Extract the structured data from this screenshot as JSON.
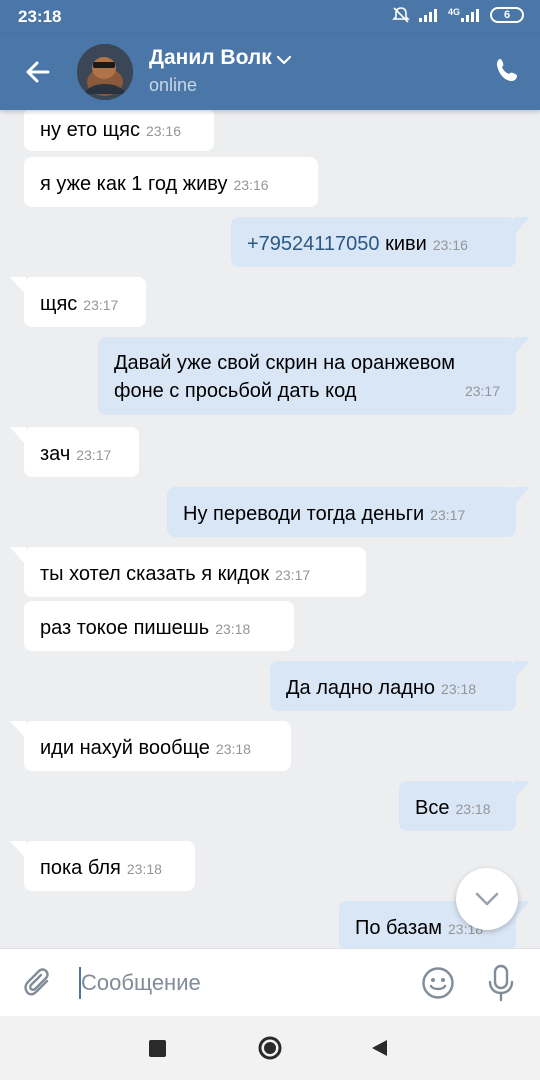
{
  "status_bar": {
    "time": "23:18",
    "network": "4G",
    "battery": "6"
  },
  "header": {
    "name": "Данил Волк",
    "status": "online"
  },
  "messages": [
    {
      "dir": "in",
      "text": "ну ето щяс",
      "time": "23:16"
    },
    {
      "dir": "in",
      "text": "я уже как 1 год живу",
      "time": "23:16"
    },
    {
      "dir": "out",
      "phone": "+79524117050",
      "text": " киви",
      "time": "23:16"
    },
    {
      "dir": "in",
      "text": "щяс",
      "time": "23:17"
    },
    {
      "dir": "out",
      "text": "Давай уже свой скрин на оранжевом фоне с просьбой дать код",
      "time": "23:17"
    },
    {
      "dir": "in",
      "text": "зач",
      "time": "23:17"
    },
    {
      "dir": "out",
      "text": "Ну переводи тогда деньги",
      "time": "23:17"
    },
    {
      "dir": "in",
      "text": "ты хотел сказать я кидок",
      "time": "23:17"
    },
    {
      "dir": "in",
      "text": "раз токое пишешь",
      "time": "23:18"
    },
    {
      "dir": "out",
      "text": "Да ладно ладно",
      "time": "23:18"
    },
    {
      "dir": "in",
      "text": "иди нахуй вообще",
      "time": "23:18"
    },
    {
      "dir": "out",
      "text": "Все",
      "time": "23:18"
    },
    {
      "dir": "in",
      "text": "пока бля",
      "time": "23:18"
    },
    {
      "dir": "out",
      "text": "По базам",
      "time": "23:18"
    }
  ],
  "composer": {
    "placeholder": "Сообщение"
  },
  "icons": {
    "back": "arrow-left-icon",
    "chevron": "chevron-down-icon",
    "call": "phone-icon",
    "scroll": "chevron-down-icon",
    "attach": "paperclip-icon",
    "emoji": "smile-icon",
    "mic": "microphone-icon",
    "nav_recent": "square-icon",
    "nav_home": "circle-icon",
    "nav_back": "triangle-icon"
  },
  "colors": {
    "accent": "#4a76a8",
    "incoming_bubble": "#ffffff",
    "outgoing_bubble": "#d9e6f5",
    "background": "#edeef0",
    "time": "#939699",
    "link": "#2a5885"
  }
}
